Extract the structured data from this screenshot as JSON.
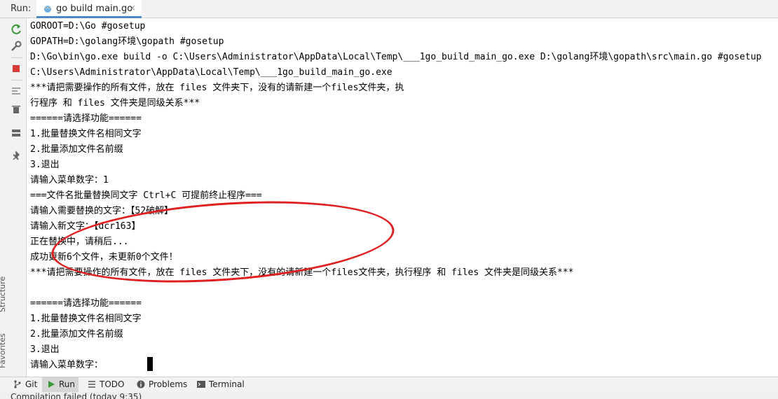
{
  "topbar": {
    "run_label": "Run:",
    "tab_title": "go build main.go",
    "tab_close": "×"
  },
  "sidebar": {
    "structure_label": "Structure",
    "favorites_label": "Favorites"
  },
  "console": {
    "lines": [
      "GOROOT=D:\\Go #gosetup",
      "GOPATH=D:\\golang环境\\gopath #gosetup",
      "D:\\Go\\bin\\go.exe build -o C:\\Users\\Administrator\\AppData\\Local\\Temp\\___1go_build_main_go.exe D:\\golang环境\\gopath\\src\\main.go #gosetup",
      "C:\\Users\\Administrator\\AppData\\Local\\Temp\\___1go_build_main_go.exe",
      "***请把需要操作的所有文件，放在 files 文件夹下，没有的请新建一个files文件夹，执",
      "行程序 和 files 文件夹是同级关系***",
      "======请选择功能======",
      "1.批量替换文件名相同文字",
      "2.批量添加文件名前缀",
      "3.退出",
      "请输入菜单数字：1",
      "===文件名批量替换同文字 Ctrl+C 可提前终止程序===",
      "请输入需要替换的文字：【52破解】",
      "请输入新文字：【dcr163】",
      "正在替换中，请稍后...",
      "成功更新6个文件，未更新0个文件！",
      "***请把需要操作的所有文件，放在 files 文件夹下，没有的请新建一个files文件夹，执行程序 和 files 文件夹是同级关系***",
      "",
      "======请选择功能======",
      "1.批量替换文件名相同文字",
      "2.批量添加文件名前缀",
      "3.退出",
      "请输入菜单数字："
    ]
  },
  "bottom_tabs": {
    "git": "Git",
    "run": "Run",
    "todo": "TODO",
    "problems": "Problems",
    "terminal": "Terminal"
  },
  "status": {
    "text": "Compilation failed (today 9:35)"
  },
  "colors": {
    "annotation": "#e02020",
    "accent": "#4a88c7",
    "rerun": "#3a9a3a",
    "stop": "#d93b3b"
  }
}
